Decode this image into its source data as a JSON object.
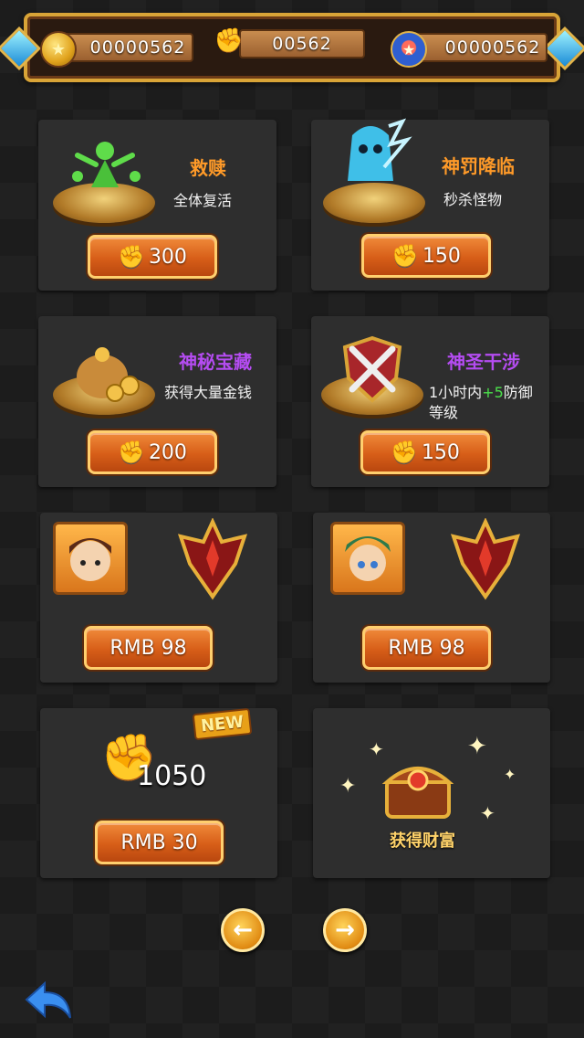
{
  "header": {
    "coins": "00000562",
    "fists": "00562",
    "gems": "00000562"
  },
  "shop": {
    "items": [
      {
        "title": "救赎",
        "desc": "全体复活",
        "price": "300"
      },
      {
        "title": "神罚降临",
        "desc": "秒杀怪物",
        "price": "150"
      },
      {
        "title": "神秘宝藏",
        "desc": "获得大量金钱",
        "price": "200"
      },
      {
        "title": "神圣干涉",
        "desc_prefix": "1小时内",
        "desc_bonus": "+5",
        "desc_suffix": "防御",
        "desc_line2": "等级",
        "price": "150"
      }
    ],
    "bundles": [
      {
        "price": "RMB 98"
      },
      {
        "price": "RMB 98"
      }
    ],
    "fist_pack": {
      "badge": "NEW",
      "amount": "1050",
      "price": "RMB 30"
    },
    "treasure": {
      "label": "获得财富"
    }
  },
  "colors": {
    "accent": "#d75e18",
    "title_orange": "#ff9a28",
    "title_purple": "#b54cf2",
    "bonus_green": "#4be04b",
    "frame_gold": "#d9a437"
  },
  "icons": {
    "coin": "coin-icon",
    "fist": "fist-icon",
    "gem": "gem-icon",
    "prev": "arrow-left-icon",
    "next": "arrow-right-icon",
    "back": "back-arrow-icon"
  }
}
